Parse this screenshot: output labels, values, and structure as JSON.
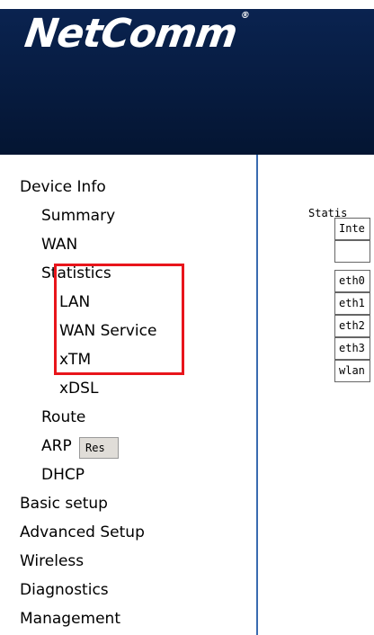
{
  "header": {
    "logo": "NetComm",
    "logo_mark": "®"
  },
  "sidebar": {
    "device_info": "Device Info",
    "summary": "Summary",
    "wan": "WAN",
    "statistics": "Statistics",
    "lan": "LAN",
    "wan_service": "WAN Service",
    "xtm": "xTM",
    "xdsl": "xDSL",
    "route": "Route",
    "arp": "ARP",
    "dhcp": "DHCP",
    "basic_setup": "Basic setup",
    "advanced_setup": "Advanced Setup",
    "wireless": "Wireless",
    "diagnostics": "Diagnostics",
    "management": "Management"
  },
  "content": {
    "title": "Statis",
    "table": {
      "header": "Inte",
      "rows": [
        "eth0",
        "eth1",
        "eth2",
        "eth3",
        "wlan"
      ]
    },
    "reset_button": "Res"
  },
  "colors": {
    "header_bg": "#061a3c",
    "highlight": "#e8151b",
    "divider": "#3a6bb0"
  }
}
